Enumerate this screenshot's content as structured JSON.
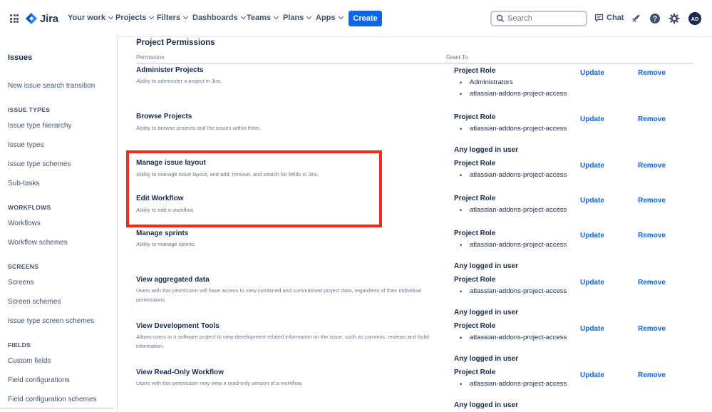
{
  "nav": {
    "logo": "Jira",
    "items": [
      "Your work",
      "Projects",
      "Filters",
      "Dashboards",
      "Teams",
      "Plans",
      "Apps"
    ],
    "create_label": "Create",
    "search_placeholder": "Search",
    "chat_label": "Chat",
    "avatar_initials": "AD",
    "accent_color": "#0c66e4"
  },
  "sidebar": {
    "title": "Issues",
    "link_new_search": "New issue search transition",
    "sections": [
      {
        "heading": "ISSUE TYPES",
        "items": [
          "Issue type hierarchy",
          "Issue types",
          "Issue type schemes",
          "Sub-tasks"
        ]
      },
      {
        "heading": "WORKFLOWS",
        "items": [
          "Workflows",
          "Workflow schemes"
        ]
      },
      {
        "heading": "SCREENS",
        "items": [
          "Screens",
          "Screen schemes",
          "Issue type screen schemes"
        ]
      },
      {
        "heading": "FIELDS",
        "items": [
          "Custom fields",
          "Field configurations",
          "Field configuration schemes"
        ]
      }
    ]
  },
  "main": {
    "title": "Project Permissions",
    "col_permission": "Permission",
    "col_grant_to": "Grant To",
    "update_label": "Update",
    "remove_label": "Remove",
    "permissions": [
      {
        "name": "Administer Projects",
        "desc": "Ability to administer a project in Jira.",
        "role": "Project Role",
        "items": [
          "Administrators",
          "atlassian-addons-project-access"
        ],
        "any": ""
      },
      {
        "name": "Browse Projects",
        "desc": "Ability to browse projects and the issues within them.",
        "role": "Project Role",
        "items": [
          "atlassian-addons-project-access"
        ],
        "any": "Any logged in user"
      },
      {
        "name": "Manage issue layout",
        "desc": "Ability to manage issue layout, and add, remove, and search for fields in Jira.",
        "role": "Project Role",
        "items": [
          "atlassian-addons-project-access"
        ],
        "any": ""
      },
      {
        "name": "Edit Workflow",
        "desc": "Ability to edit a workflow.",
        "role": "Project Role",
        "items": [
          "atlassian-addons-project-access"
        ],
        "any": ""
      },
      {
        "name": "Manage sprints",
        "desc": "Ability to manage sprints.",
        "role": "Project Role",
        "items": [
          "atlassian-addons-project-access"
        ],
        "any": "Any logged in user"
      },
      {
        "name": "View aggregated data",
        "desc": "Users with this permission will have access to view combined and summarised project data, regardless of their individual permissions.",
        "role": "Project Role",
        "items": [
          "atlassian-addons-project-access"
        ],
        "any": "Any logged in user"
      },
      {
        "name": "View Development Tools",
        "desc": "Allows users in a software project to view development-related information on the issue, such as commits, reviews and build information.",
        "role": "Project Role",
        "items": [
          "atlassian-addons-project-access"
        ],
        "any": "Any logged in user"
      },
      {
        "name": "View Read-Only Workflow",
        "desc": "Users with this permission may view a read-only version of a workflow.",
        "role": "Project Role",
        "items": [
          "atlassian-addons-project-access"
        ],
        "any": "Any logged in user"
      }
    ]
  },
  "annotation": {
    "highlight_color": "#ff2a12"
  }
}
